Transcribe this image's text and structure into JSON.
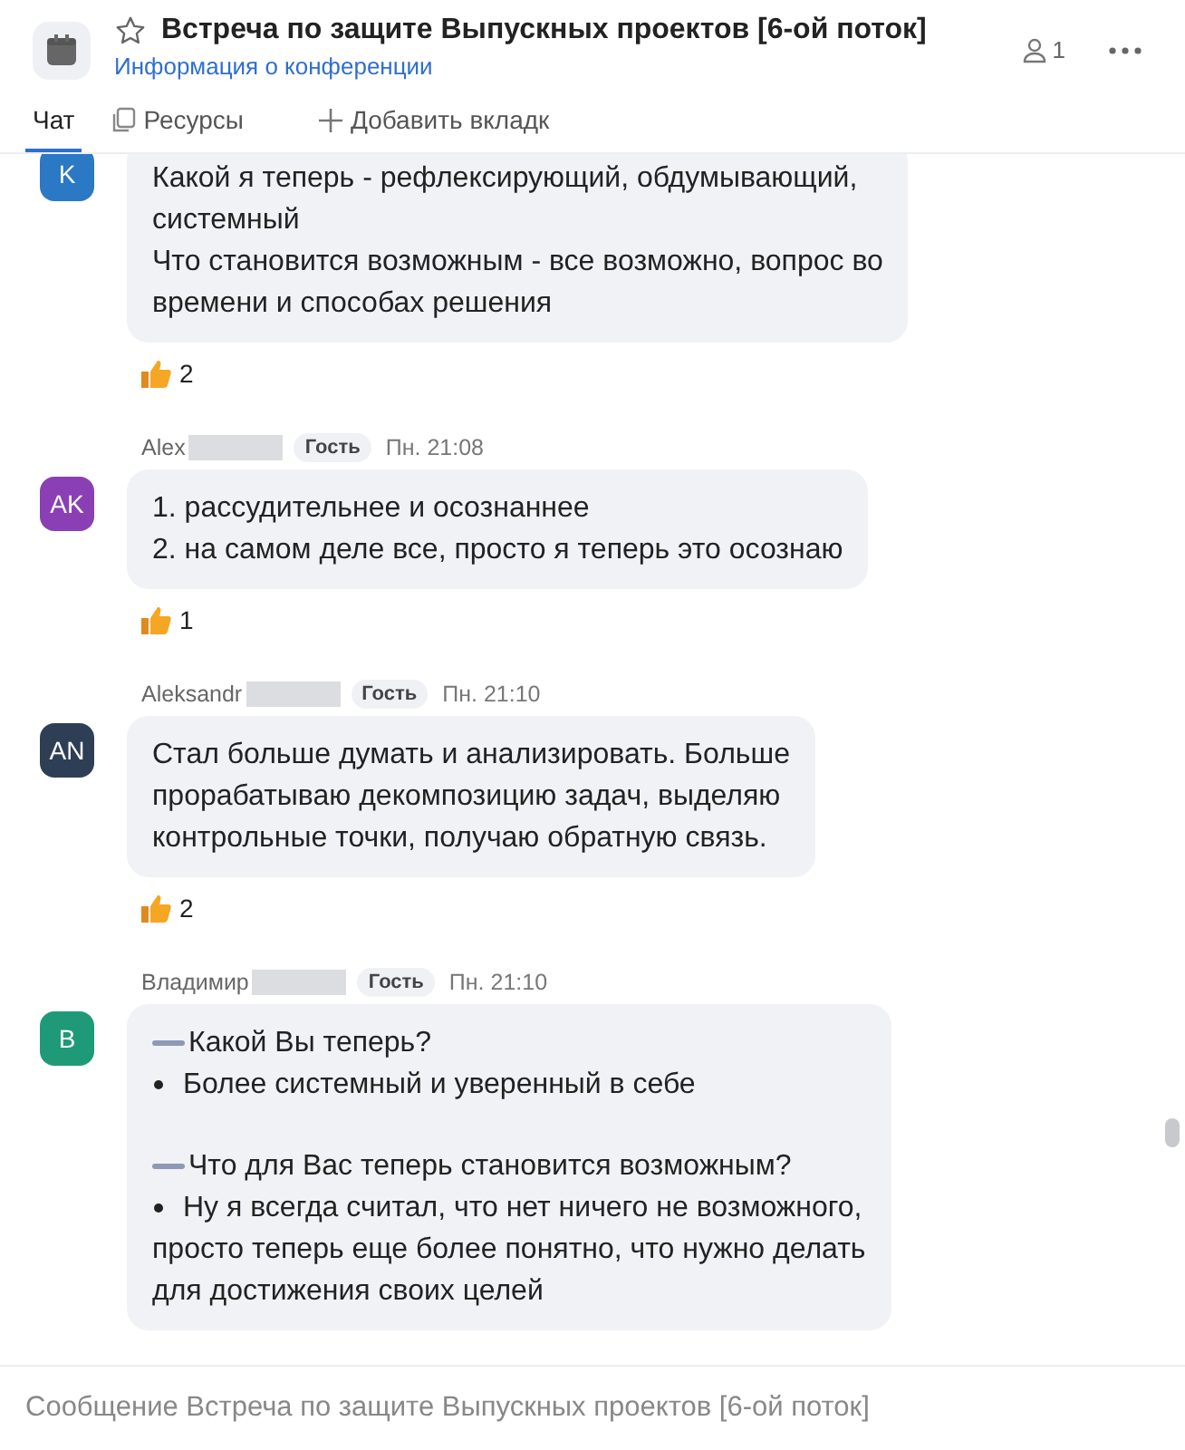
{
  "header": {
    "title": "Встреча по защите Выпускных проектов [6-ой поток]",
    "info_link": "Информация о конференции",
    "participants": "1"
  },
  "tabs": [
    {
      "label": "Чат",
      "selected": true,
      "kind": "plain"
    },
    {
      "label": "Ресурсы",
      "selected": false,
      "kind": "resources"
    },
    {
      "label": "Добавить вкладк",
      "selected": false,
      "kind": "add"
    }
  ],
  "messages": [
    {
      "avatar": "K",
      "color": "#2b78c5",
      "lines": [
        {
          "kind": "text",
          "text": "Какой я теперь - рефлексирующий, обдумывающий,"
        },
        {
          "kind": "text",
          "text": "системный"
        },
        {
          "kind": "text",
          "text": "Что становится возможным - все возможно, вопрос во"
        },
        {
          "kind": "text",
          "text": "времени и способах решения"
        }
      ],
      "reaction_count": "2"
    },
    {
      "sender": "Alex",
      "role": "Гость",
      "time": "Пн. 21:08",
      "avatar": "AK",
      "color": "#8b3fb5",
      "lines": [
        {
          "kind": "text",
          "text": "1. рассудительнее и осознаннее"
        },
        {
          "kind": "text",
          "text": "2. на самом деле все, просто я теперь это осознаю"
        }
      ],
      "reaction_count": "1"
    },
    {
      "sender": "Aleksandr",
      "role": "Гость",
      "time": "Пн. 21:10",
      "avatar": "AN",
      "color": "#2e3f55",
      "lines": [
        {
          "kind": "text",
          "text": "Стал больше думать и анализировать. Больше"
        },
        {
          "kind": "text",
          "text": "прорабатываю декомпозицию задач, выделяю"
        },
        {
          "kind": "text",
          "text": "контрольные точки, получаю обратную связь."
        }
      ],
      "reaction_count": "2"
    },
    {
      "sender": "Владимир",
      "role": "Гость",
      "time": "Пн. 21:10",
      "avatar": "В",
      "color": "#1f9a78",
      "lines": [
        {
          "kind": "heading",
          "text": "Какой Вы теперь?"
        },
        {
          "kind": "bullet",
          "text": "Более системный и уверенный в себе"
        },
        {
          "kind": "heading",
          "text": "Что для Вас теперь становится возможным?"
        },
        {
          "kind": "bullet",
          "text": "Ну я всегда считал, что нет ничего не возможного,"
        },
        {
          "kind": "text",
          "text": "просто теперь еще более понятно, что нужно делать"
        },
        {
          "kind": "text",
          "text": "для достижения своих целей"
        }
      ]
    }
  ],
  "composer": {
    "placeholder": "Сообщение Встреча по защите Выпускных проектов [6-ой поток]"
  }
}
